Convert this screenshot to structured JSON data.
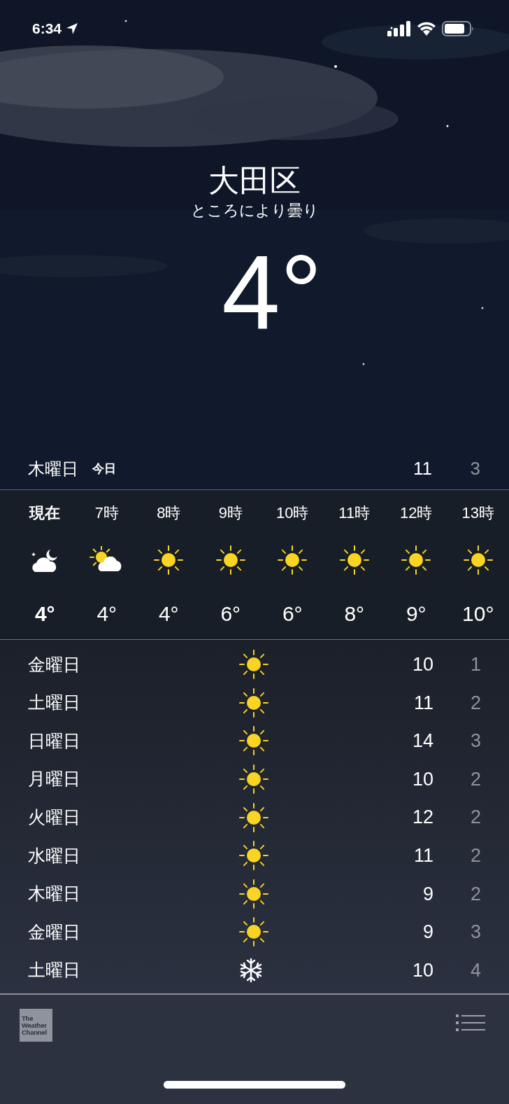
{
  "status_bar": {
    "time": "6:34"
  },
  "location": {
    "city": "大田区",
    "condition": "ところにより曇り",
    "temperature": "4°"
  },
  "today": {
    "day": "木曜日",
    "badge": "今日",
    "high": "11",
    "low": "3"
  },
  "hourly": [
    {
      "time": "現在",
      "kind": "moon-cloud",
      "temp": "4°",
      "now": true
    },
    {
      "time": "7時",
      "kind": "sun-cloud",
      "temp": "4°",
      "now": false
    },
    {
      "time": "8時",
      "kind": "sun",
      "temp": "4°",
      "now": false
    },
    {
      "time": "9時",
      "kind": "sun",
      "temp": "6°",
      "now": false
    },
    {
      "time": "10時",
      "kind": "sun",
      "temp": "6°",
      "now": false
    },
    {
      "time": "11時",
      "kind": "sun",
      "temp": "8°",
      "now": false
    },
    {
      "time": "12時",
      "kind": "sun",
      "temp": "9°",
      "now": false
    },
    {
      "time": "13時",
      "kind": "sun",
      "temp": "10°",
      "now": false
    }
  ],
  "daily": [
    {
      "day": "金曜日",
      "kind": "sun",
      "high": "10",
      "low": "1"
    },
    {
      "day": "土曜日",
      "kind": "sun",
      "high": "11",
      "low": "2"
    },
    {
      "day": "日曜日",
      "kind": "sun",
      "high": "14",
      "low": "3"
    },
    {
      "day": "月曜日",
      "kind": "sun",
      "high": "10",
      "low": "2"
    },
    {
      "day": "火曜日",
      "kind": "sun",
      "high": "12",
      "low": "2"
    },
    {
      "day": "水曜日",
      "kind": "sun",
      "high": "11",
      "low": "2"
    },
    {
      "day": "木曜日",
      "kind": "sun",
      "high": "9",
      "low": "2"
    },
    {
      "day": "金曜日",
      "kind": "sun",
      "high": "9",
      "low": "3"
    },
    {
      "day": "土曜日",
      "kind": "snow",
      "high": "10",
      "low": "4"
    }
  ],
  "footer": {
    "logo": "The Weather Channel"
  }
}
